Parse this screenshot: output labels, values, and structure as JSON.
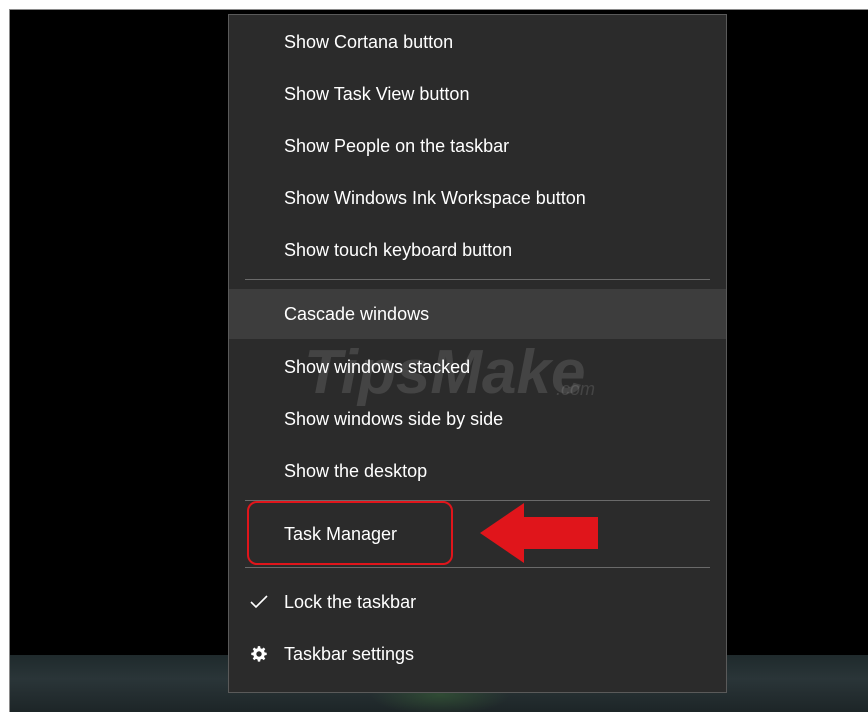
{
  "context_menu": {
    "items": [
      {
        "label": "Show Cortana button"
      },
      {
        "label": "Show Task View button"
      },
      {
        "label": "Show People on the taskbar"
      },
      {
        "label": "Show Windows Ink Workspace button"
      },
      {
        "label": "Show touch keyboard button"
      },
      {
        "label": "Cascade windows",
        "hovered": true
      },
      {
        "label": "Show windows stacked"
      },
      {
        "label": "Show windows side by side"
      },
      {
        "label": "Show the desktop"
      },
      {
        "label": "Task Manager",
        "annotated": true
      },
      {
        "label": "Lock the taskbar",
        "checked": true,
        "icon": "checkmark-icon"
      },
      {
        "label": "Taskbar settings",
        "icon": "gear-icon"
      }
    ]
  },
  "annotation": {
    "highlight_color": "#e0151b",
    "arrow_color": "#e0151b",
    "pointer_icon": "left-arrow-icon"
  },
  "watermark": {
    "text": "TipsMake",
    "suffix": ".com"
  },
  "colors": {
    "menu_background": "#2b2b2b",
    "menu_hover": "#3d3d3d",
    "menu_text": "#ffffff",
    "desktop_background": "#000000"
  }
}
